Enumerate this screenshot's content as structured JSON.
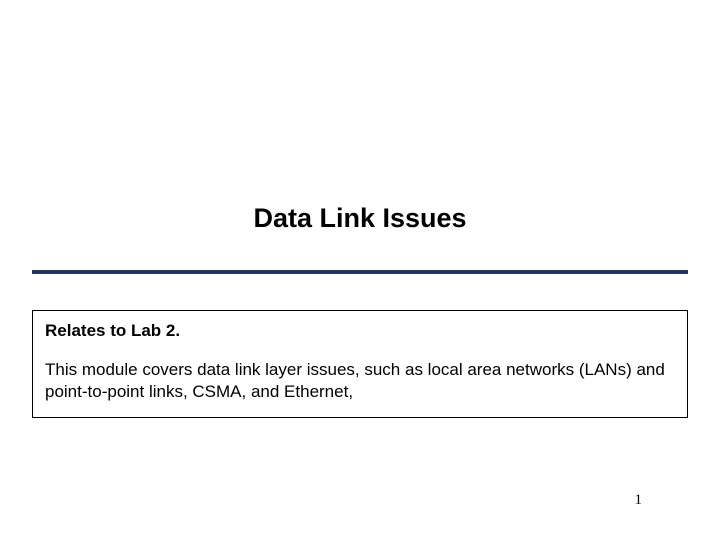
{
  "slide": {
    "title": "Data Link Issues",
    "subtitle": "Relates to Lab 2.",
    "description": "This module covers data link layer issues, such as local area networks (LANs) and point-to-point links, CSMA, and Ethernet,",
    "page_number": "1"
  }
}
